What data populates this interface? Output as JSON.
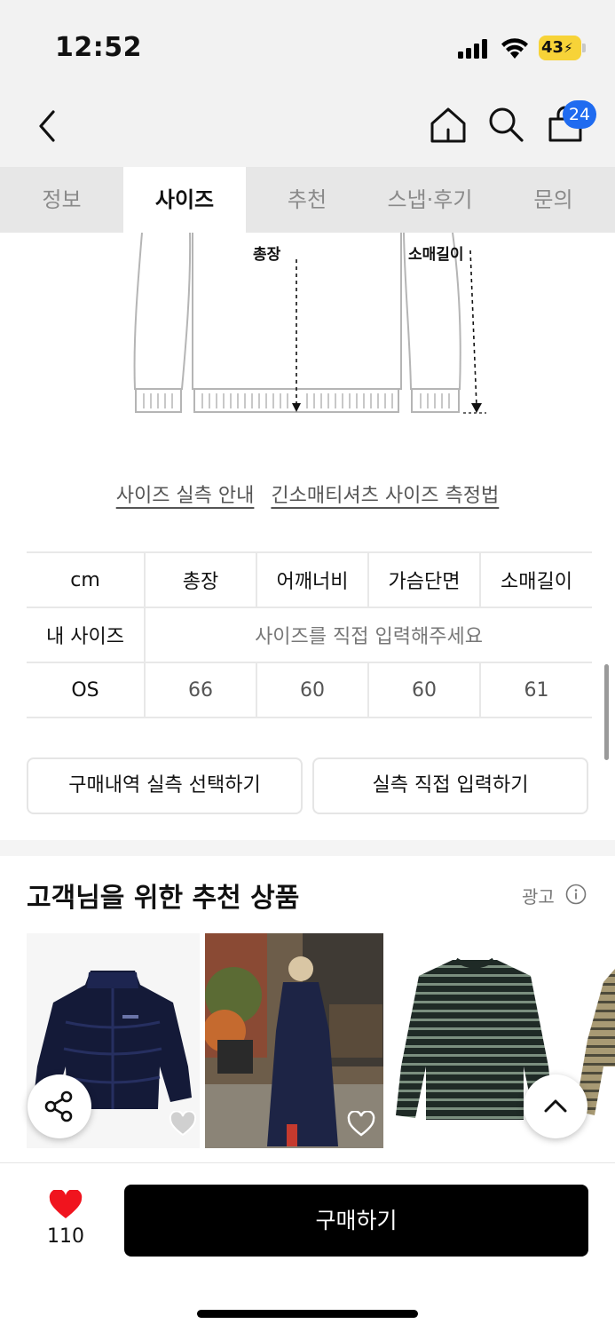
{
  "status_bar": {
    "time": "12:52",
    "battery": "43"
  },
  "nav": {
    "cart_count": "24"
  },
  "tabs": [
    {
      "label": "정보",
      "active": false
    },
    {
      "label": "사이즈",
      "active": true
    },
    {
      "label": "추천",
      "active": false
    },
    {
      "label": "스냅·후기",
      "active": false
    },
    {
      "label": "문의",
      "active": false
    }
  ],
  "diagram": {
    "length_label": "총장",
    "sleeve_label": "소매길이"
  },
  "links": {
    "size_guide": "사이즈 실측 안내",
    "measure_method": "긴소매티셔츠 사이즈 측정법"
  },
  "size_table": {
    "unit": "cm",
    "columns": [
      "총장",
      "어깨너비",
      "가슴단면",
      "소매길이"
    ],
    "my_size_label": "내 사이즈",
    "my_size_placeholder": "사이즈를 직접 입력해주세요",
    "rows": [
      {
        "size": "OS",
        "values": [
          "66",
          "60",
          "60",
          "61"
        ]
      }
    ]
  },
  "buttons": {
    "purchase_history": "구매내역 실측 선택하기",
    "direct_input": "실측 직접 입력하기"
  },
  "recommendations": {
    "title": "고객님을 위한 추천 상품",
    "ad_label": "광고",
    "products": [
      {
        "image": "navy-puffer-jacket"
      },
      {
        "image": "navy-hoodie-dress-snap"
      },
      {
        "image": "striped-longsleeve-tee"
      },
      {
        "image": "beige-striped-tee"
      }
    ]
  },
  "bottom_bar": {
    "like_count": "110",
    "buy_label": "구매하기"
  },
  "colors": {
    "accent_blue": "#1f6bf0",
    "like_red": "#f0141e",
    "buy_black": "#000000"
  }
}
